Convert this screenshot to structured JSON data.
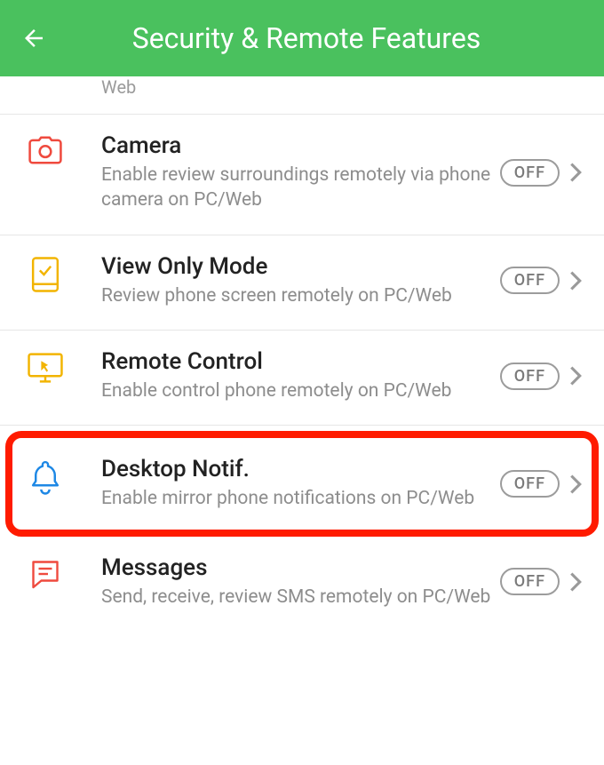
{
  "header": {
    "title": "Security & Remote Features"
  },
  "partial_item_desc": "Web",
  "items": [
    {
      "id": "camera",
      "title": "Camera",
      "desc": "Enable review surroundings remotely via phone camera on PC/Web",
      "state": "OFF",
      "icon_color": "#ef4a3e",
      "highlighted": false
    },
    {
      "id": "view-only-mode",
      "title": "View Only Mode",
      "desc": "Review phone screen remotely on PC/Web",
      "state": "OFF",
      "icon_color": "#f2b400",
      "highlighted": false
    },
    {
      "id": "remote-control",
      "title": "Remote Control",
      "desc": "Enable control phone remotely on PC/Web",
      "state": "OFF",
      "icon_color": "#f2b400",
      "highlighted": false
    },
    {
      "id": "desktop-notif",
      "title": "Desktop Notif.",
      "desc": "Enable mirror phone notifications on PC/Web",
      "state": "OFF",
      "icon_color": "#1e88e5",
      "highlighted": true
    },
    {
      "id": "messages",
      "title": "Messages",
      "desc": "Send, receive, review SMS remotely on PC/Web",
      "state": "OFF",
      "icon_color": "#ef4a3e",
      "highlighted": false
    }
  ]
}
